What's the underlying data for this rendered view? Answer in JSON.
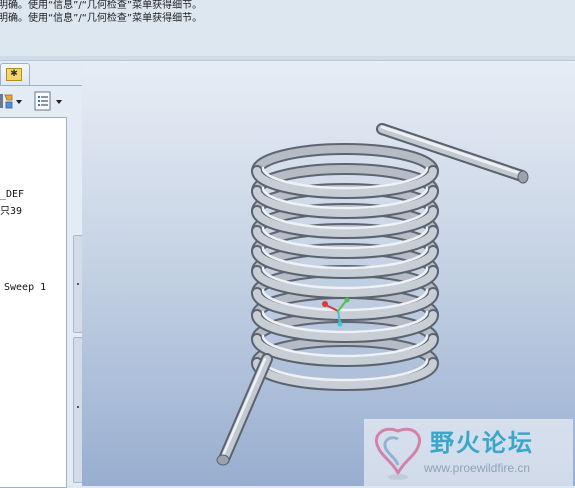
{
  "message_area": {
    "lines": [
      "明确。使用“信息”/“几何检查”菜单获得细节。",
      "明确。使用“信息”/“几何检查”菜单获得细节。"
    ]
  },
  "left_panel": {
    "tab_icon": "folder-star-icon",
    "tab_glyph": "✱",
    "toolbar": {
      "show_menu_icon": "show-menu-icon",
      "settings_menu_icon": "settings-menu-icon"
    },
    "model_tree": {
      "items": [
        {
          "label": "_DEF"
        },
        {
          "label": "只39"
        },
        {
          "label": "Sweep 1"
        }
      ]
    }
  },
  "viewport": {
    "model": "helical-spring-sweep",
    "csys": {
      "x_color": "#d93a3a",
      "y_color": "#4cc34c",
      "z_color": "#3bc7d6"
    }
  },
  "watermark": {
    "title": "野火论坛",
    "url": "www.proewildfire.cn"
  },
  "colors": {
    "viewport_top": "#e7edf5",
    "viewport_bottom": "#98aed0",
    "accent": "#3aa7c9"
  }
}
